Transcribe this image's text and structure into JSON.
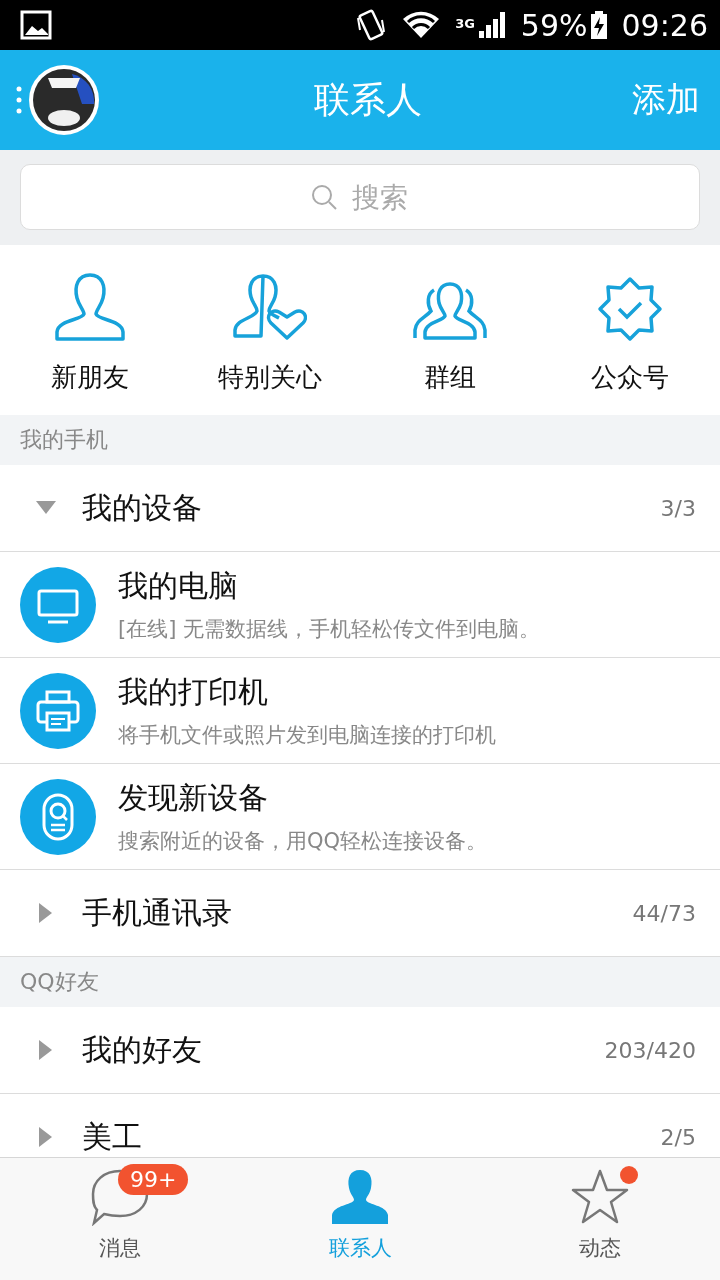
{
  "status_bar": {
    "network": "3G",
    "battery": "59%",
    "time": "09:26"
  },
  "header": {
    "title": "联系人",
    "action": "添加"
  },
  "search": {
    "placeholder": "搜索"
  },
  "shortcuts": [
    {
      "label": "新朋友"
    },
    {
      "label": "特别关心"
    },
    {
      "label": "群组"
    },
    {
      "label": "公众号"
    }
  ],
  "sections": [
    {
      "title": "我的手机",
      "items": [
        {
          "kind": "group",
          "name": "我的设备",
          "count": "3/3",
          "expanded": true
        },
        {
          "kind": "computer",
          "name": "我的电脑",
          "description": "[在线] 无需数据线，手机轻松传文件到电脑。"
        },
        {
          "kind": "printer",
          "name": "我的打印机",
          "description": "将手机文件或照片发到电脑连接的打印机"
        },
        {
          "kind": "finder",
          "name": "发现新设备",
          "description": "搜索附近的设备，用QQ轻松连接设备。"
        },
        {
          "kind": "group",
          "name": "手机通讯录",
          "count": "44/73",
          "expanded": false
        }
      ]
    },
    {
      "title": "QQ好友",
      "items": [
        {
          "kind": "group",
          "name": "我的好友",
          "count": "203/420",
          "expanded": false
        },
        {
          "kind": "group",
          "name": "美工",
          "count": "2/5",
          "expanded": false
        }
      ]
    }
  ],
  "tabs": [
    {
      "label": "消息",
      "selected": false,
      "badge": "99+",
      "dot": false
    },
    {
      "label": "联系人",
      "selected": true,
      "dot": false
    },
    {
      "label": "动态",
      "selected": false,
      "dot": true
    }
  ]
}
